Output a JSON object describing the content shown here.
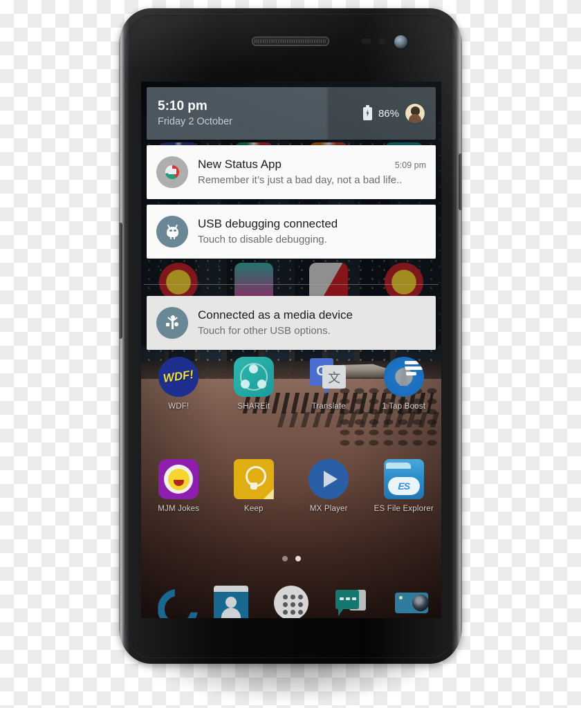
{
  "device": {
    "name": "smartphone-mockup",
    "hardware": {
      "earpiece": "earpiece-speaker",
      "front_camera": "front-camera",
      "proximity_sensor": "proximity-sensor",
      "light_sensor": "light-sensor",
      "volume_rocker": "volume-rocker",
      "power_button": "power-button"
    }
  },
  "status_header": {
    "time": "5:10 pm",
    "date": "Friday 2 October",
    "battery_percent": "86%",
    "battery_icon": "battery-charging-icon",
    "avatar": "user-avatar"
  },
  "notifications": [
    {
      "icon": "new-status-app-icon",
      "title": "New Status App",
      "time": "5:09 pm",
      "text": "Remember it’s just a bad day, not a bad life..",
      "style": "light"
    },
    {
      "icon": "android-bug-icon",
      "title": "USB debugging connected",
      "time": "",
      "text": "Touch to disable debugging.",
      "style": "light"
    },
    {
      "icon": "usb-icon",
      "title": "Connected as a media device",
      "time": "",
      "text": "Touch for other USB options.",
      "style": "dim"
    }
  ],
  "home_screen": {
    "rows": [
      {
        "apps": [
          {
            "label": "WDF!",
            "icon": "wdf-app-icon"
          },
          {
            "label": "SHAREit",
            "icon": "shareit-app-icon"
          },
          {
            "label": "Translate",
            "icon": "google-translate-app-icon"
          },
          {
            "label": "1 Tap Boost",
            "icon": "one-tap-boost-app-icon"
          }
        ]
      },
      {
        "apps": [
          {
            "label": "MJM Jokes",
            "icon": "mjm-jokes-app-icon"
          },
          {
            "label": "Keep",
            "icon": "google-keep-app-icon"
          },
          {
            "label": "MX Player",
            "icon": "mx-player-app-icon"
          },
          {
            "label": "ES File Explorer",
            "icon": "es-file-explorer-app-icon"
          }
        ]
      }
    ],
    "page_indicator": {
      "total": 2,
      "active": 2
    },
    "dock": [
      {
        "icon": "phone-dialer-icon",
        "label": "Phone"
      },
      {
        "icon": "contacts-icon",
        "label": "Contacts"
      },
      {
        "icon": "app-drawer-icon",
        "label": "Apps"
      },
      {
        "icon": "messaging-icon",
        "label": "Messaging"
      },
      {
        "icon": "camera-icon",
        "label": "Camera"
      }
    ]
  },
  "colors": {
    "status_header_bg": "#4b565e",
    "notification_bg": "#fafafa",
    "notification_bg_dim": "#e6e6e6",
    "notification_icon_blue": "#6a8795",
    "title_text": "#1b1b1b",
    "secondary_text": "#6d6d6d"
  }
}
